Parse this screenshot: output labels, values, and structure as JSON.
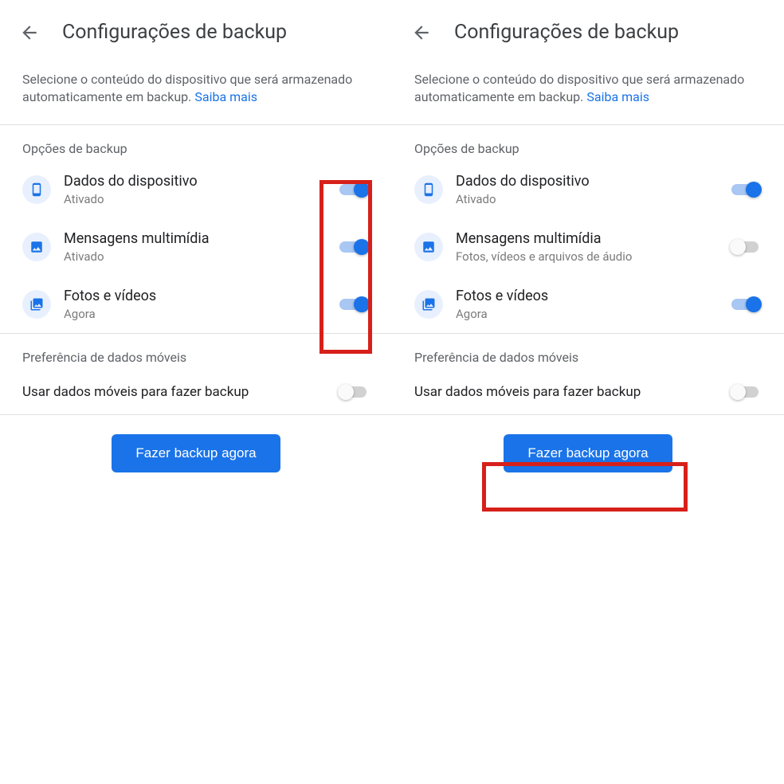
{
  "header": {
    "title": "Configurações de backup"
  },
  "intro": {
    "text": "Selecione o conteúdo do dispositivo que será armazenado automaticamente em backup. ",
    "link": "Saiba mais"
  },
  "sections": {
    "options_label": "Opções de backup",
    "pref_label": "Preferência de dados móveis",
    "mobile_data_label": "Usar dados móveis para fazer backup"
  },
  "left": {
    "items": [
      {
        "title": "Dados do dispositivo",
        "sub": "Ativado",
        "on": true
      },
      {
        "title": "Mensagens multimídia",
        "sub": "Ativado",
        "on": true
      },
      {
        "title": "Fotos e vídeos",
        "sub": "Agora",
        "on": true
      }
    ],
    "mobile_on": false
  },
  "right": {
    "items": [
      {
        "title": "Dados do dispositivo",
        "sub": "Ativado",
        "on": true
      },
      {
        "title": "Mensagens multimídia",
        "sub": "Fotos, vídeos e arquivos de áudio",
        "on": false
      },
      {
        "title": "Fotos e vídeos",
        "sub": "Agora",
        "on": true
      }
    ],
    "mobile_on": false
  },
  "button": {
    "label": "Fazer backup agora"
  },
  "colors": {
    "accent": "#1a73e8",
    "highlight": "#d7201a"
  }
}
